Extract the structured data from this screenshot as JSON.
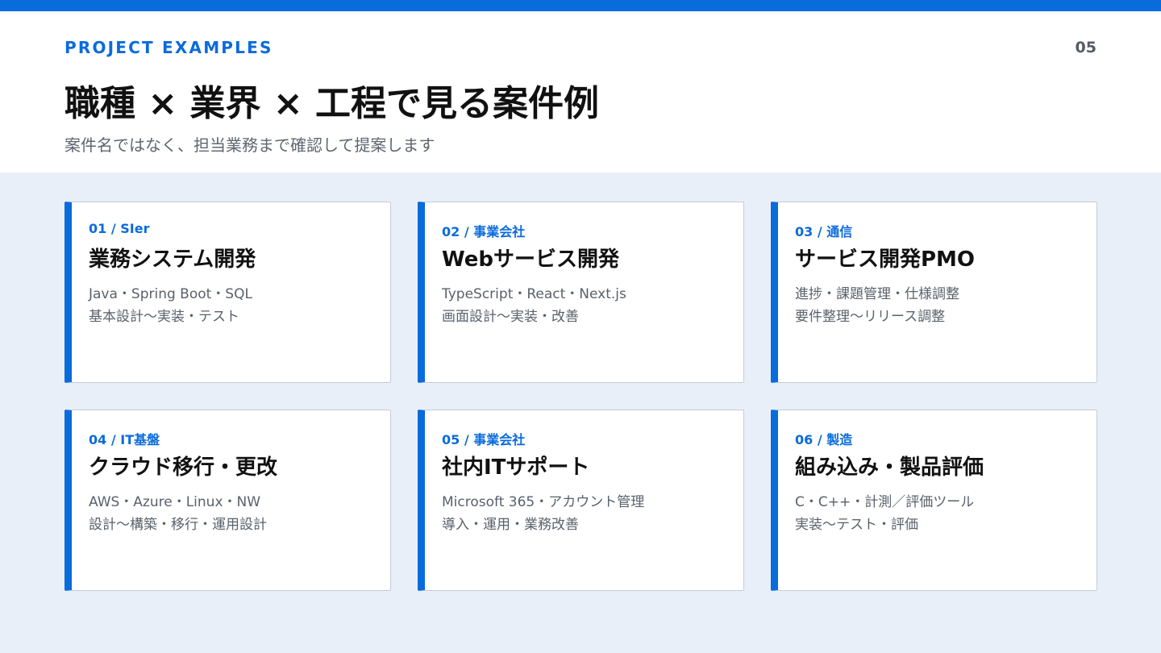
{
  "header": {
    "eyebrow": "PROJECT EXAMPLES",
    "page_number": "05",
    "title": "職種 × 業界 × 工程で見る案件例",
    "subtitle": "案件名ではなく、担当業務まで確認して提案します"
  },
  "colors": {
    "accent": "#0a6bdc",
    "content_background": "#e8eff9",
    "card_background": "#ffffff"
  },
  "cards": [
    {
      "tag": "01 / SIer",
      "title": "業務システム開発",
      "line1": "Java・Spring Boot・SQL",
      "line2": "基本設計～実装・テスト"
    },
    {
      "tag": "02 / 事業会社",
      "title": "Webサービス開発",
      "line1": "TypeScript・React・Next.js",
      "line2": "画面設計～実装・改善"
    },
    {
      "tag": "03 / 通信",
      "title": "サービス開発PMO",
      "line1": "進捗・課題管理・仕様調整",
      "line2": "要件整理～リリース調整"
    },
    {
      "tag": "04 / IT基盤",
      "title": "クラウド移行・更改",
      "line1": "AWS・Azure・Linux・NW",
      "line2": "設計～構築・移行・運用設計"
    },
    {
      "tag": "05 / 事業会社",
      "title": "社内ITサポート",
      "line1": "Microsoft 365・アカウント管理",
      "line2": "導入・運用・業務改善"
    },
    {
      "tag": "06 / 製造",
      "title": "組み込み・製品評価",
      "line1": "C・C++・計測／評価ツール",
      "line2": "実装～テスト・評価"
    }
  ]
}
